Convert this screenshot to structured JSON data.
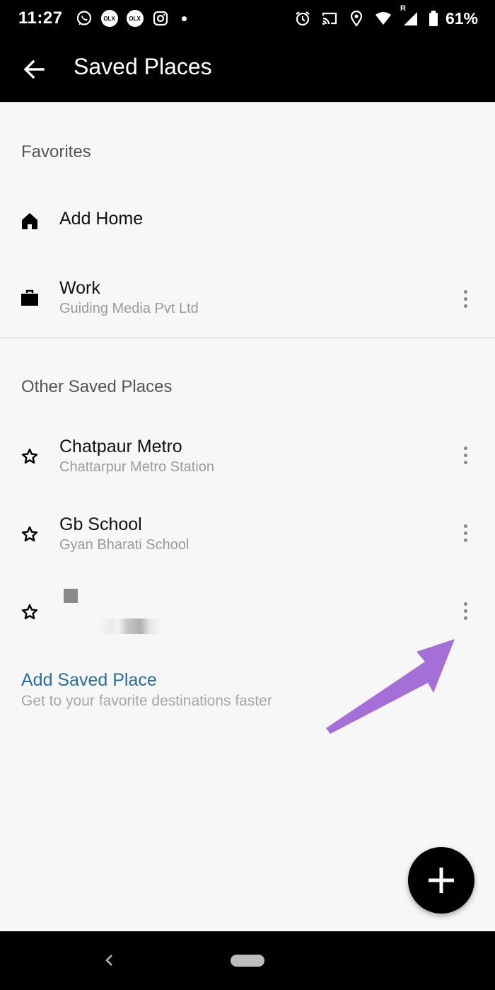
{
  "status_bar": {
    "time": "11:27",
    "olx_label": "OLX",
    "battery": "61%",
    "network_flag": "R",
    "icons": [
      "whatsapp-icon",
      "olx-icon",
      "olx-icon",
      "instagram-icon",
      "alarm-icon",
      "cast-icon",
      "location-icon",
      "wifi-icon",
      "signal-icon",
      "battery-icon"
    ]
  },
  "app_bar": {
    "title": "Saved Places",
    "back_icon": "arrow-back-icon"
  },
  "favorites": {
    "heading": "Favorites",
    "items": [
      {
        "icon": "home-icon",
        "title": "Add Home",
        "subtitle": ""
      },
      {
        "icon": "briefcase-icon",
        "title": "Work",
        "subtitle": "Guiding Media Pvt Ltd"
      }
    ]
  },
  "other_places": {
    "heading": "Other Saved Places",
    "items": [
      {
        "icon": "star-outline-icon",
        "title": "Chatpaur Metro",
        "subtitle": "Chattarpur Metro Station"
      },
      {
        "icon": "star-outline-icon",
        "title": "Gb School",
        "subtitle": "Gyan Bharati School"
      },
      {
        "icon": "star-outline-icon",
        "title": "",
        "subtitle": ""
      }
    ]
  },
  "add_saved_place": {
    "label": "Add Saved Place",
    "subtitle": "Get to your favorite destinations faster"
  },
  "colors": {
    "accent_link": "#276fa3",
    "annotation_arrow": "#a46fd6",
    "app_bar": "#000000",
    "background": "#f7f7f7"
  }
}
